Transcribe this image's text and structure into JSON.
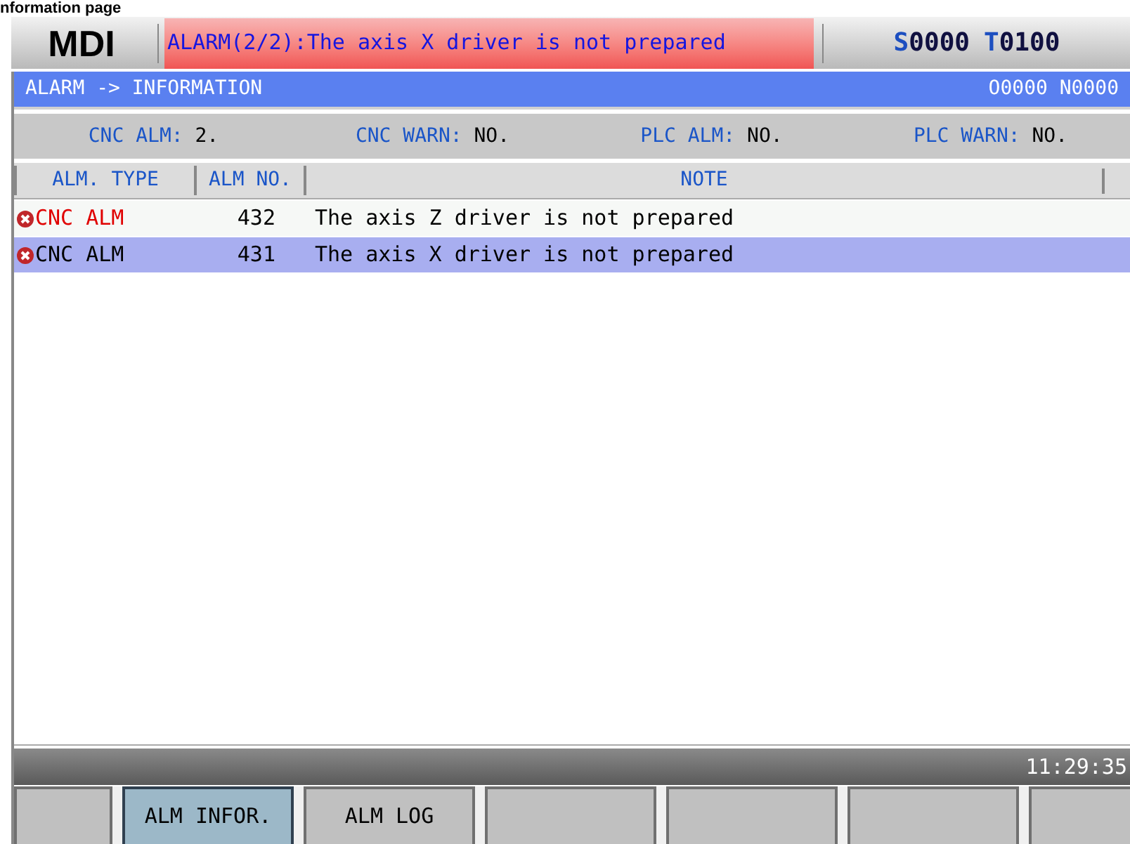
{
  "caption": "nformation page",
  "header": {
    "mode": "MDI",
    "alarm_message": "ALARM(2/2):The axis X driver is not prepared",
    "spindle_letter": "S",
    "spindle_value": "0000",
    "tool_letter": "T",
    "tool_value": "0100"
  },
  "title_bar": {
    "title": "ALARM -> INFORMATION",
    "program": "O0000 N0000"
  },
  "summary": [
    {
      "label": "CNC ALM:",
      "value": "2."
    },
    {
      "label": "CNC WARN:",
      "value": "NO."
    },
    {
      "label": "PLC ALM:",
      "value": "NO."
    },
    {
      "label": "PLC WARN:",
      "value": "NO."
    }
  ],
  "table": {
    "columns": [
      "ALM. TYPE",
      "ALM NO.",
      "NOTE"
    ],
    "rows": [
      {
        "type": "CNC ALM",
        "number": "432",
        "note": "The axis Z driver is not prepared",
        "selected": false
      },
      {
        "type": "CNC ALM",
        "number": "431",
        "note": "The axis X driver is not prepared",
        "selected": true
      }
    ]
  },
  "status_bar": {
    "time": "11:29:35"
  },
  "soft_keys": [
    {
      "selected": false
    },
    {
      "label": "ALM INFOR.",
      "selected": true
    },
    {
      "label": "ALM LOG",
      "selected": false
    },
    {
      "selected": false
    },
    {
      "selected": false
    },
    {
      "selected": false
    },
    {
      "selected": false
    }
  ]
}
